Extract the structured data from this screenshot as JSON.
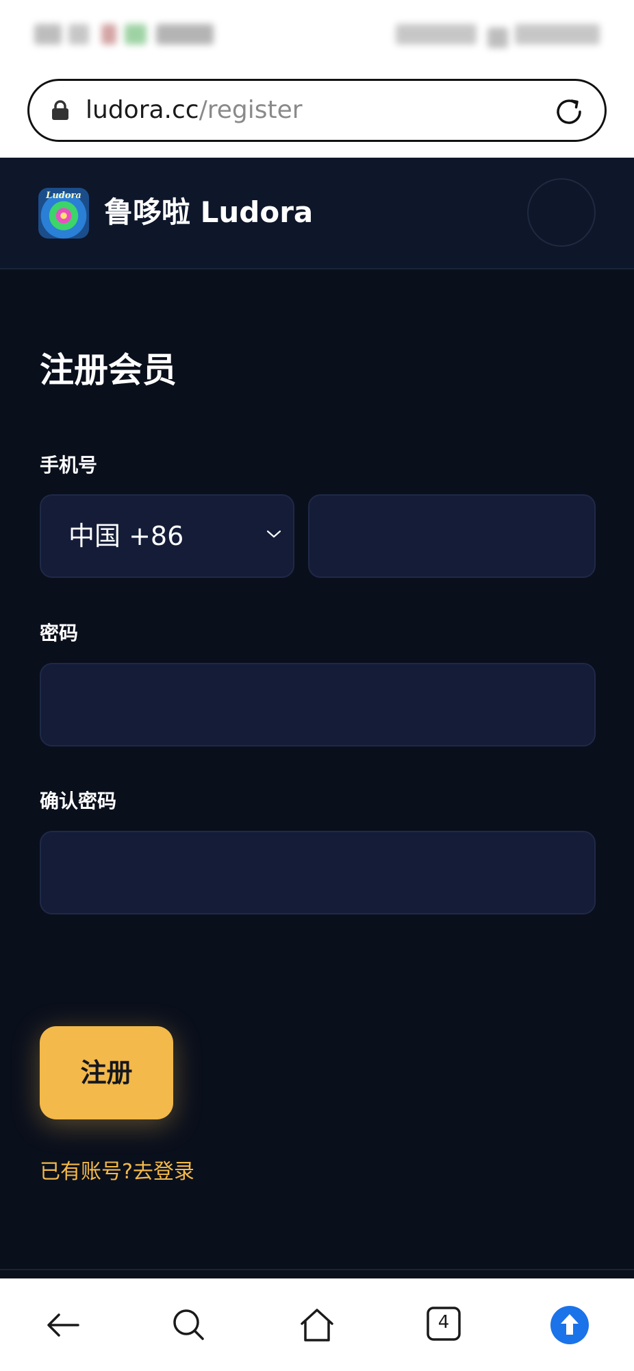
{
  "browser": {
    "url_domain": "ludora.cc",
    "url_path": "/register",
    "tab_count": "4"
  },
  "header": {
    "logo_text": "Ludora",
    "site_title": "鲁哆啦 Ludora"
  },
  "form": {
    "title": "注册会员",
    "phone_label": "手机号",
    "country_value": "中国 +86",
    "phone_value": "",
    "password_label": "密码",
    "password_value": "",
    "confirm_label": "确认密码",
    "confirm_value": "",
    "submit_label": "注册",
    "login_link": "已有账号?去登录"
  },
  "colors": {
    "background": "#0a0f1c",
    "header_bg": "#0e162a",
    "input_bg": "#141c38",
    "accent": "#f3b94a",
    "nav_accent": "#1a73e8"
  },
  "icons": {
    "url_bar": [
      "lock-icon",
      "reload-icon"
    ],
    "bottom_nav": [
      "back-arrow-icon",
      "search-icon",
      "home-icon",
      "tabs-icon",
      "upload-icon"
    ],
    "form": [
      "chevron-down-icon"
    ]
  }
}
